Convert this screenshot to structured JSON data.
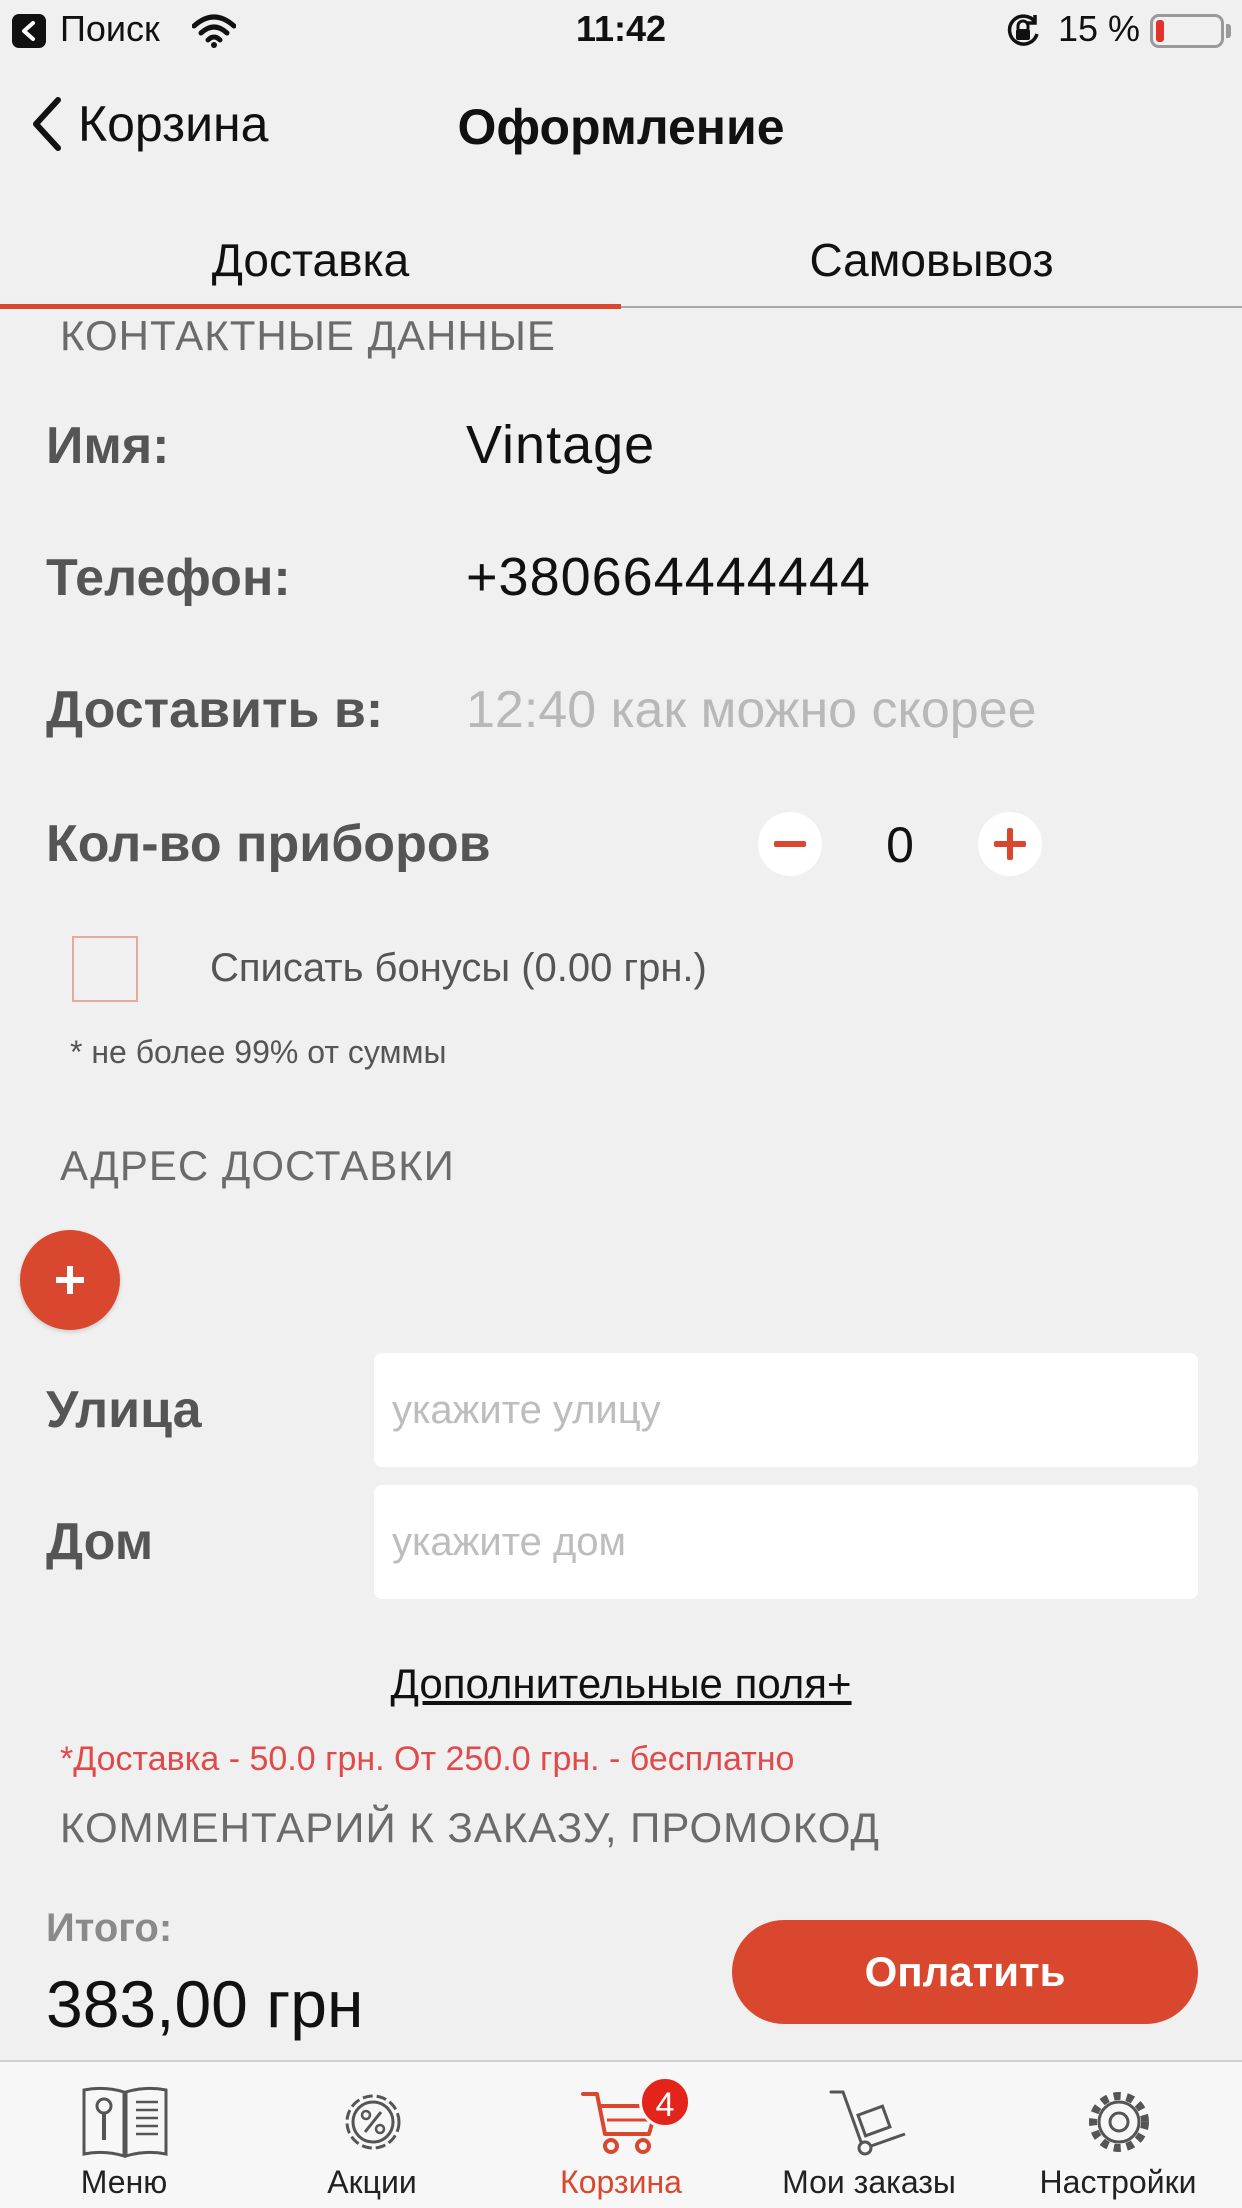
{
  "status_bar": {
    "back_app": "Поиск",
    "time": "11:42",
    "battery_percent": "15 %",
    "battery_level": 0.15
  },
  "nav": {
    "back_label": "Корзина",
    "title": "Оформление"
  },
  "tabs": {
    "items": [
      {
        "label": "Доставка",
        "active": true
      },
      {
        "label": "Самовывоз",
        "active": false
      }
    ]
  },
  "contact": {
    "section_title": "КОНТАКТНЫЕ ДАННЫЕ",
    "name_label": "Имя:",
    "name_value": "Vintage",
    "phone_label": "Телефон:",
    "phone_value": "+380664444444",
    "deliver_label": "Доставить в:",
    "deliver_placeholder": "12:40 как можно скорее",
    "cutlery_label": "Кол-во приборов",
    "cutlery_value": "0",
    "bonus_label": "Списать бонусы  (0.00 грн.)",
    "bonus_checked": false,
    "bonus_note": "* не более 99% от суммы"
  },
  "address": {
    "section_title": "АДРЕС ДОСТАВКИ",
    "street_label": "Улица",
    "street_placeholder": "укажите улицу",
    "house_label": "Дом",
    "house_placeholder": "укажите дом",
    "extra_fields_label": "Дополнительные поля+",
    "delivery_note": "*Доставка - 50.0 грн. От 250.0 грн. - бесплатно"
  },
  "comment": {
    "section_title": "КОММЕНТАРИЙ К ЗАКАЗУ, ПРОМОКОД"
  },
  "summary": {
    "total_label": "Итого:",
    "total_value": "383,00 грн",
    "pay_label": "Оплатить"
  },
  "tabbar": {
    "items": [
      {
        "label": "Меню",
        "icon": "menu-book-icon",
        "active": false
      },
      {
        "label": "Акции",
        "icon": "discount-gear-icon",
        "active": false
      },
      {
        "label": "Корзина",
        "icon": "cart-icon",
        "active": true,
        "badge": "4"
      },
      {
        "label": "Мои заказы",
        "icon": "hand-truck-icon",
        "active": false
      },
      {
        "label": "Настройки",
        "icon": "gear-icon",
        "active": false
      }
    ]
  },
  "colors": {
    "accent": "#d9482e",
    "background": "#f0f0f0",
    "badge": "#e3241b",
    "note_red": "#e04a4a"
  }
}
